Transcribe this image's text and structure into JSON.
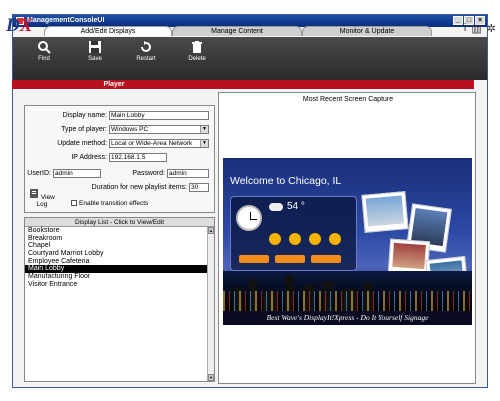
{
  "window": {
    "title": "ManagementConsoleUI",
    "min": "_",
    "max": "□",
    "close": "×"
  },
  "logo": {
    "d": "D",
    "x": "X"
  },
  "tabs": [
    {
      "label": "Add/Edit Displays"
    },
    {
      "label": "Manage Content"
    },
    {
      "label": "Monitor & Update"
    }
  ],
  "top_icons": {
    "info": "i",
    "book": "▥",
    "gear": "✲"
  },
  "toolbar": {
    "find": "Find",
    "save": "Save",
    "restart": "Restart",
    "delete": "Delete"
  },
  "section": {
    "player": "Player"
  },
  "form": {
    "display_name_label": "Display name:",
    "display_name": "Main Lobby",
    "player_type_label": "Type of player:",
    "player_type": "Windows PC",
    "update_method_label": "Update method:",
    "update_method": "Local or Wide-Area Network",
    "ip_label": "IP Address:",
    "ip": "192.168.1.5",
    "userid_label": "UserID:",
    "userid": "admin",
    "password_label": "Password:",
    "password": "admin",
    "duration_label": "Duration for new playlist items:",
    "duration": "30",
    "view_log": "View Log",
    "transitions_label": "Enable transition effects"
  },
  "display_list": {
    "header": "Display List - Click to View/Edit",
    "items": [
      "Bookstore",
      "Breakroom",
      "Chapel",
      "Courtyard Marriot Lobby",
      "Employee Cafeteria",
      "Main Lobby",
      "Manufacturing Floor",
      "Visitor Entrance"
    ],
    "selected": "Main Lobby"
  },
  "capture": {
    "title": "Most Recent Screen Capture",
    "welcome": "Welcome to Chicago, IL",
    "temp": "54 °",
    "tagline": "Best Wave's DisplayIt!Xpress - Do It Yourself Signage"
  },
  "colors": {
    "accent": "#b8101e",
    "titlebar": "#0a2c7c",
    "toolbar": "#2a2a2a"
  }
}
